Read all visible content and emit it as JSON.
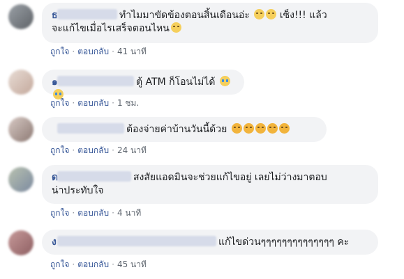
{
  "comments": [
    {
      "text_line1": "ทำไมมาขัดข้องตอนสิ้นเดือนอ่ะ",
      "text_line1_tail": "เซ็ง!!! แล้ว",
      "text_line2": "จะแก้ไขเมื่อไรเสร็จตอนไหน",
      "emojis_line1": [
        "sad-emoji",
        "sad-emoji"
      ],
      "emojis_line2": [
        "neutral-emoji"
      ],
      "like": "ถูกใจ",
      "reply": "ตอบกลับ",
      "time": "41 นาที"
    },
    {
      "text_line1": "ตู้ ATM ก็โอนไม่ได้",
      "emojis_line1": [
        "crying-emoji",
        "crying-emoji"
      ],
      "like": "ถูกใจ",
      "reply": "ตอบกลับ",
      "time": "1 ชม."
    },
    {
      "text_line1": "ต้องจ่ายค่าบ้านวันนี้ด้วย",
      "emojis_line1": [
        "angry-emoji",
        "angry-emoji",
        "angry-emoji",
        "angry-emoji",
        "angry-emoji"
      ],
      "like": "ถูกใจ",
      "reply": "ตอบกลับ",
      "time": "24 นาที"
    },
    {
      "text_line1": "สงสัยแอดมินจะช่วยแก้ไขอยู่ เลยไม่ว่างมาตอบ",
      "text_line2": "น่าประทับใจ",
      "like": "ถูกใจ",
      "reply": "ตอบกลับ",
      "time": "4 นาที"
    },
    {
      "text_line1": "แก้ไขด่วนๆๆๆๆๆๆๆๆๆๆๆๆๆๆ คะ",
      "like": "ถูกใจ",
      "reply": "ตอบกลับ",
      "time": "45 นาที"
    }
  ],
  "separator": "·",
  "colors": {
    "bubble": "#f2f3f5",
    "link": "#385898",
    "meta": "#606770"
  }
}
